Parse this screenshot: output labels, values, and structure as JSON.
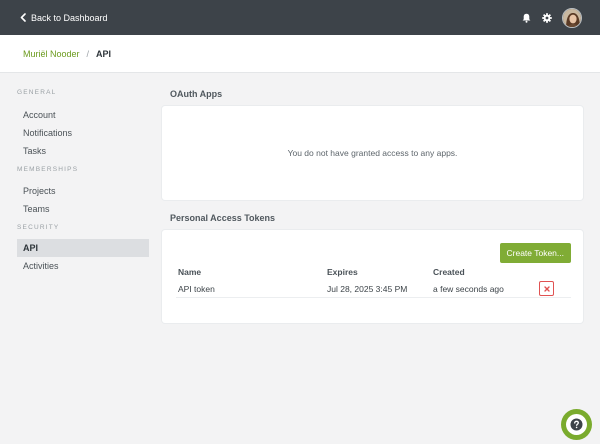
{
  "topbar": {
    "back_label": "Back to Dashboard",
    "icons": [
      "chevron-left-icon",
      "bell-icon",
      "gear-icon",
      "avatar"
    ]
  },
  "breadcrumb": {
    "user": "Muriël Nooder",
    "separator": "/",
    "current": "API"
  },
  "sidebar": {
    "groups": [
      {
        "heading": "GENERAL",
        "items": [
          {
            "label": "Account"
          },
          {
            "label": "Notifications"
          },
          {
            "label": "Tasks"
          }
        ]
      },
      {
        "heading": "MEMBERSHIPS",
        "items": [
          {
            "label": "Projects"
          },
          {
            "label": "Teams"
          }
        ]
      },
      {
        "heading": "SECURITY",
        "items": [
          {
            "label": "API",
            "active": true
          },
          {
            "label": "Activities"
          }
        ]
      }
    ]
  },
  "oauth": {
    "title": "OAuth Apps",
    "empty_message": "You do not have granted access to any apps."
  },
  "tokens": {
    "title": "Personal Access Tokens",
    "create_label": "Create Token...",
    "columns": [
      "Name",
      "Expires",
      "Created"
    ],
    "rows": [
      {
        "name": "API token",
        "expires": "Jul 28, 2025 3:45 PM",
        "created": "a few seconds ago"
      }
    ]
  },
  "help": {
    "icon": "question-icon"
  },
  "colors": {
    "topbar": "#3d4349",
    "accent_green": "#80ac35",
    "link_green": "#6b9a1d",
    "danger": "#e05252",
    "background": "#f3f3f4"
  }
}
